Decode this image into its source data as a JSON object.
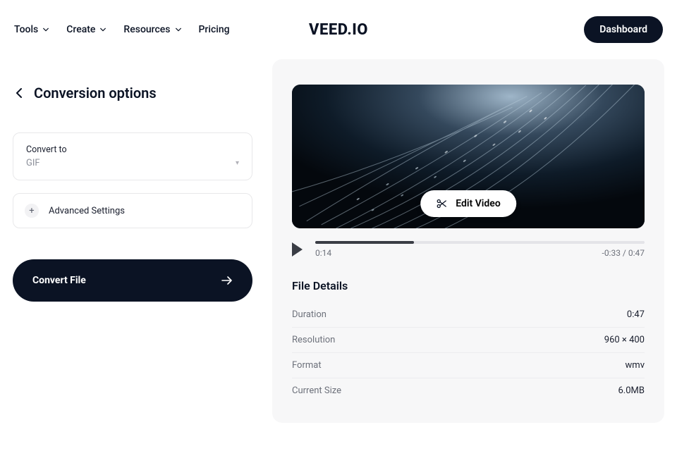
{
  "nav": {
    "tools": "Tools",
    "create": "Create",
    "resources": "Resources",
    "pricing": "Pricing"
  },
  "logo": "VEED.IO",
  "dashboard": "Dashboard",
  "page_title": "Conversion options",
  "convert_to_label": "Convert to",
  "convert_to_value": "GIF",
  "advanced": "Advanced Settings",
  "convert_button": "Convert File",
  "edit_video": "Edit Video",
  "player": {
    "current": "0:14",
    "remain_total": "-0:33 / 0:47"
  },
  "details": {
    "title": "File Details",
    "duration_k": "Duration",
    "duration_v": "0:47",
    "resolution_k": "Resolution",
    "resolution_v": "960 × 400",
    "format_k": "Format",
    "format_v": "wmv",
    "size_k": "Current Size",
    "size_v": "6.0MB"
  }
}
